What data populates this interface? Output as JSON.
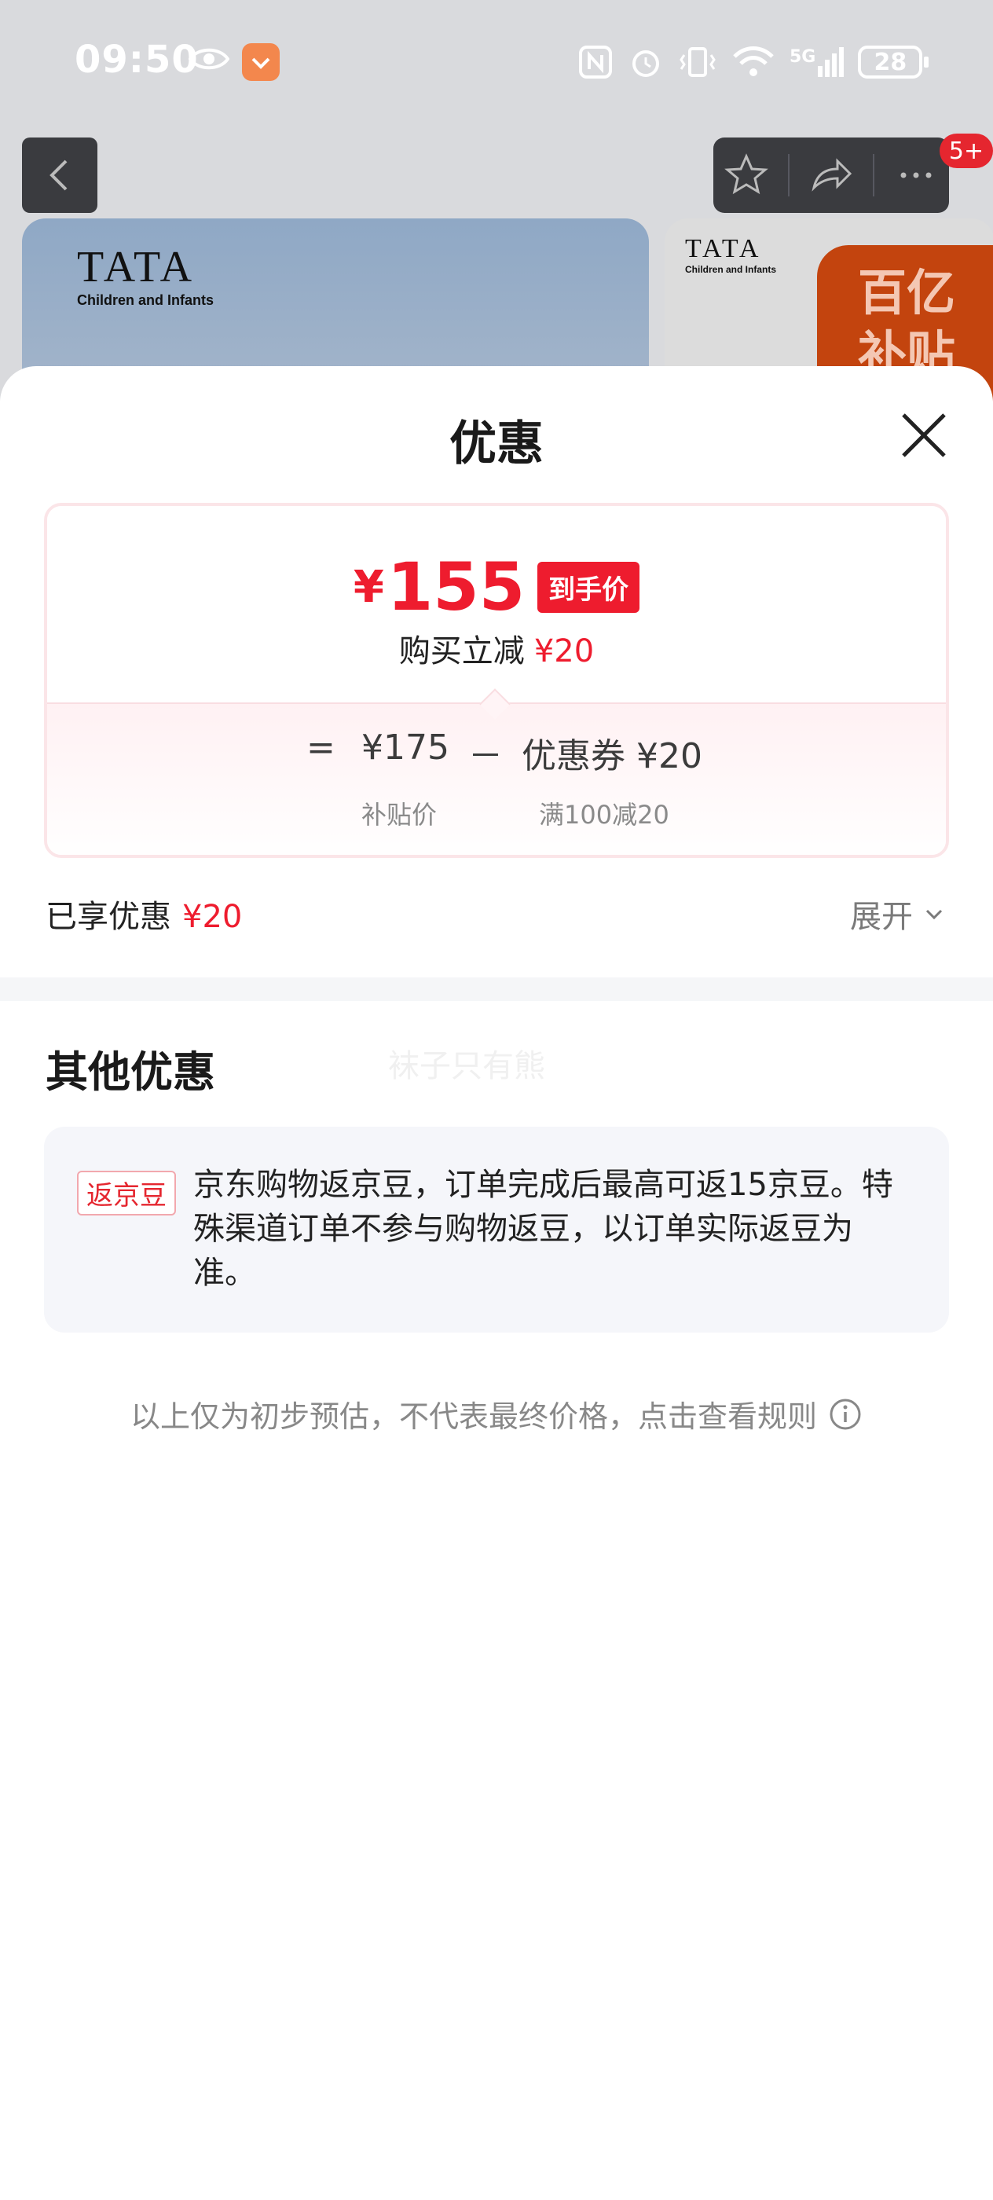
{
  "status": {
    "time": "09:50",
    "network": "5G",
    "battery": "28"
  },
  "nav": {
    "badge": "5+"
  },
  "products": {
    "left_brand": "TATA",
    "left_brand_sub": "Children and Infants",
    "right_brand": "TATA",
    "right_brand_sub": "Children and Infants",
    "promo_line1": "百亿",
    "promo_line2": "补贴"
  },
  "sheet": {
    "title": "优惠",
    "price": {
      "currency": "¥",
      "amount": "155",
      "tag": "到手价",
      "discount_label": "购买立减",
      "discount_value": "¥20"
    },
    "formula": {
      "equals": "=",
      "base": "¥175",
      "minus": "－",
      "coupon": "优惠券 ¥20",
      "base_label": "补贴价",
      "coupon_label": "满100减20"
    },
    "enjoyed": {
      "label": "已享优惠",
      "value": "¥20"
    },
    "expand_label": "展开",
    "other_title": "其他优惠",
    "watermark": "袜子只有熊",
    "bean": {
      "tag": "返京豆",
      "text": "京东购物返京豆，订单完成后最高可返15京豆。特殊渠道订单不参与购物返豆，以订单实际返豆为准。"
    },
    "note": "以上仅为初步预估，不代表最终价格，点击查看规则"
  },
  "colors": {
    "accent_red": "#ee1c2e",
    "overlay": "#d9dadd"
  }
}
